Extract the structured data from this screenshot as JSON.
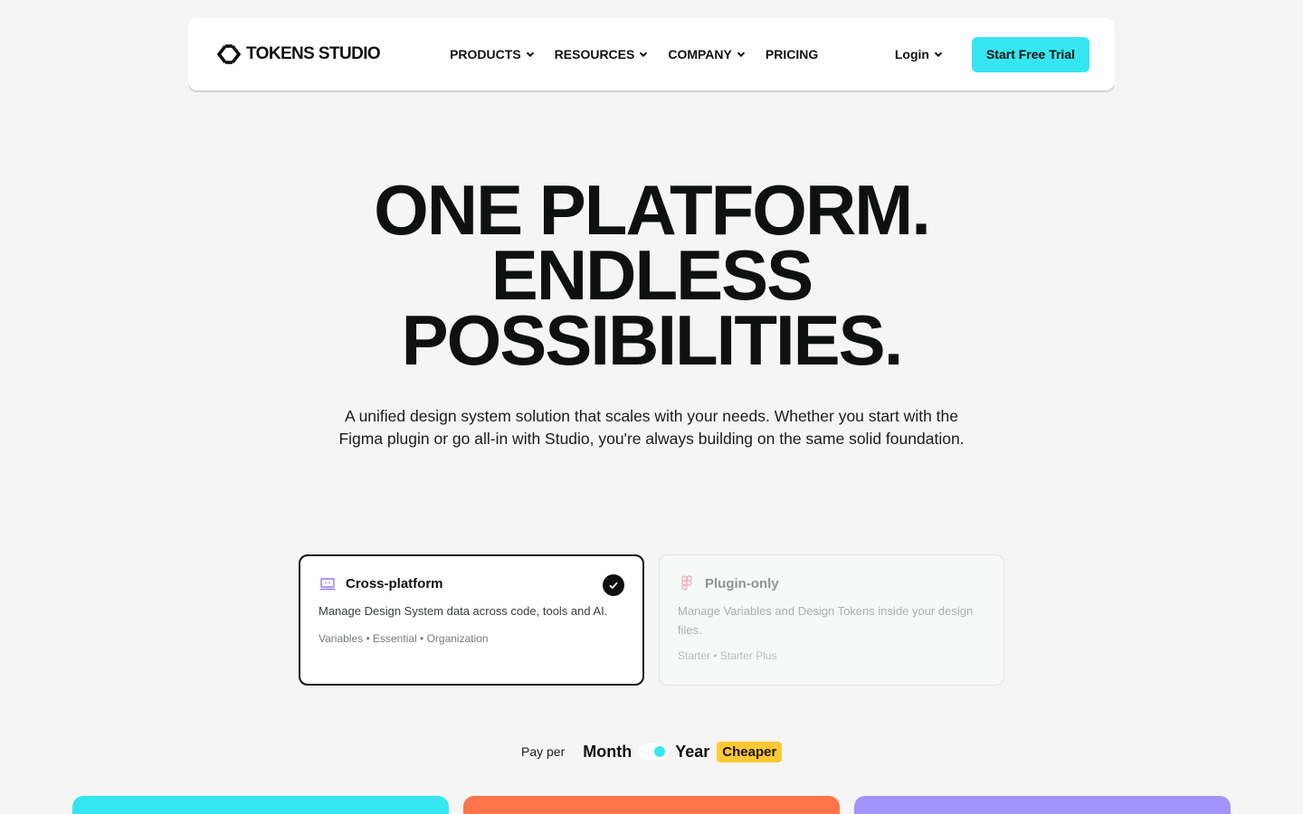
{
  "nav": {
    "logo_text": "TOKENS STUDIO",
    "menu": [
      {
        "label": "PRODUCTS",
        "dropdown": true
      },
      {
        "label": "RESOURCES",
        "dropdown": true
      },
      {
        "label": "COMPANY",
        "dropdown": true
      },
      {
        "label": "PRICING",
        "dropdown": false
      }
    ],
    "login_label": "Login",
    "cta_label": "Start Free Trial"
  },
  "hero": {
    "title_lines": [
      "ONE PLATFORM.",
      "ENDLESS",
      "POSSIBILITIES."
    ],
    "subtitle_line1": "A unified design system solution that scales with your needs. Whether you start with the",
    "subtitle_line2": "Figma plugin or go all-in with Studio, you're always building on the same solid foundation."
  },
  "plans": [
    {
      "title": "Cross-platform",
      "description": "Manage Design System data across code, tools and AI.",
      "tags": "Variables • Essential • Organization",
      "selected": true,
      "icon": "monitor-icon"
    },
    {
      "title": "Plugin-only",
      "description": "Manage Variables and Design Tokens inside your design files.",
      "tags": "Starter • Starter Plus",
      "selected": false,
      "icon": "figma-icon"
    }
  ],
  "billing": {
    "pay_per_label": "Pay per",
    "month_label": "Month",
    "year_label": "Year",
    "badge_label": "Cheaper",
    "selected": "Year"
  },
  "colors": {
    "accent_cyan": "#35e6f0",
    "accent_orange": "#ff7448",
    "accent_purple": "#a394fb",
    "badge_yellow": "#ffc933",
    "background": "#f4f5f4"
  }
}
